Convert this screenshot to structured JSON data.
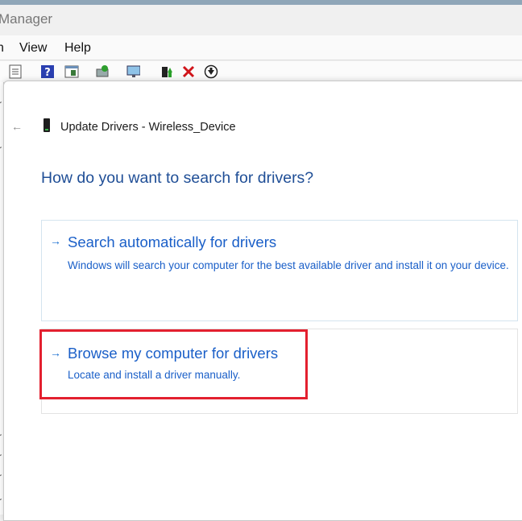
{
  "background_window": {
    "title": "Manager",
    "menu": [
      "n",
      "View",
      "Help"
    ],
    "toolbar_icons": [
      "properties-icon",
      "help-icon",
      "action-pane-icon",
      "scan-hardware-icon",
      "monitor-icon",
      "update-driver-icon",
      "uninstall-icon",
      "disable-icon"
    ],
    "left_glyphs": [
      "r",
      "r",
      "r",
      "r",
      "r",
      "r"
    ]
  },
  "dialog": {
    "title": "Update Drivers - Wireless_Device",
    "question": "How do you want to search for drivers?",
    "options": [
      {
        "title": "Search automatically for drivers",
        "description": "Windows will search your computer for the best available driver and install it on your device."
      },
      {
        "title": "Browse my computer for drivers",
        "description": "Locate and install a driver manually."
      }
    ]
  },
  "colors": {
    "link_blue": "#1a5fc8",
    "question_blue": "#1f4e96",
    "highlight_red": "#e3202f"
  }
}
